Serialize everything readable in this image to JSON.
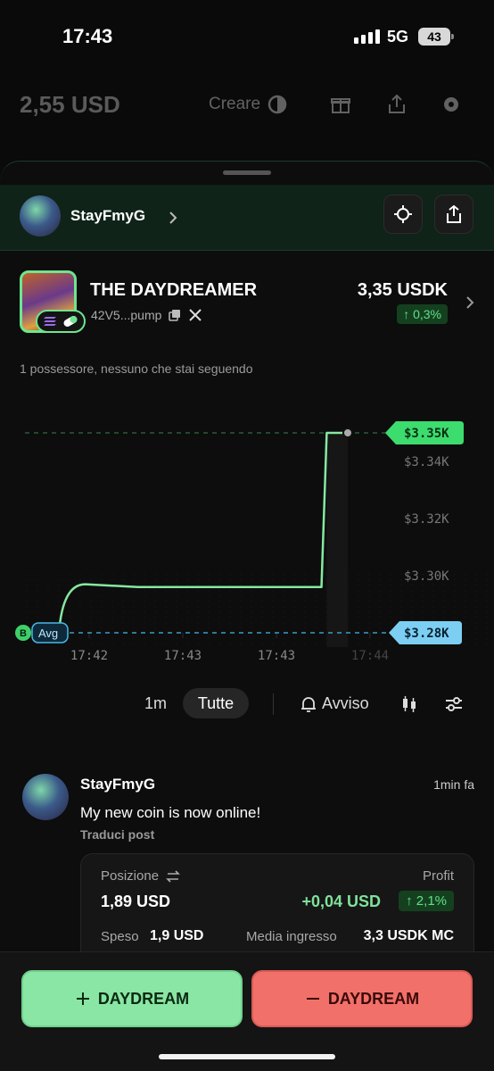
{
  "status": {
    "time": "17:43",
    "network": "5G",
    "battery": "43"
  },
  "topbar": {
    "balance": "2,55 USD",
    "create_label": "Creare"
  },
  "creator": {
    "username": "StayFmyG"
  },
  "token": {
    "name": "THE DAYDREAMER",
    "address": "42V5...pump",
    "price": "3,35 USDK",
    "change": "↑ 0,3%",
    "holders_text": "1 possessore, nessuno che stai seguendo"
  },
  "chart_data": {
    "type": "line",
    "x": [
      "17:42:00",
      "17:42:10",
      "17:42:30",
      "17:43:00",
      "17:43:30",
      "17:43:40",
      "17:43:42",
      "17:43:50"
    ],
    "values": [
      3.28,
      3.297,
      3.296,
      3.296,
      3.296,
      3.296,
      3.35,
      3.35
    ],
    "ylabel": "",
    "xlabel": "",
    "x_ticks": [
      "17:42",
      "17:43",
      "17:43",
      "17:44"
    ],
    "y_ticks": [
      "$3.34K",
      "$3.32K",
      "$3.30K",
      "$3.28K"
    ],
    "current_label": "$3.35K",
    "avg_label": "$3.28K",
    "avg_tag": "Avg",
    "buy_marker": "B",
    "ylim": [
      3.275,
      3.36
    ],
    "grid": true,
    "colors": {
      "line": "#86e8a0",
      "avg": "#49b8e8",
      "current": "#3ddc6e"
    }
  },
  "range": {
    "interval_1m": "1m",
    "interval_all": "Tutte",
    "alert_label": "Avviso"
  },
  "post": {
    "author": "StayFmyG",
    "time": "1min fa",
    "text": "My new coin is now online!",
    "translate": "Traduci post",
    "position_label": "Posizione",
    "position_value": "1,89 USD",
    "profit_label": "Profit",
    "profit_value": "+0,04 USD",
    "profit_pct": "↑ 2,1%",
    "spent_label": "Speso",
    "spent_value": "1,9 USD",
    "avg_entry_label": "Media ingresso",
    "avg_entry_value": "3,3 USDK MC"
  },
  "actions": {
    "buy_label": "DAYDREAM",
    "sell_label": "DAYDREAM"
  }
}
